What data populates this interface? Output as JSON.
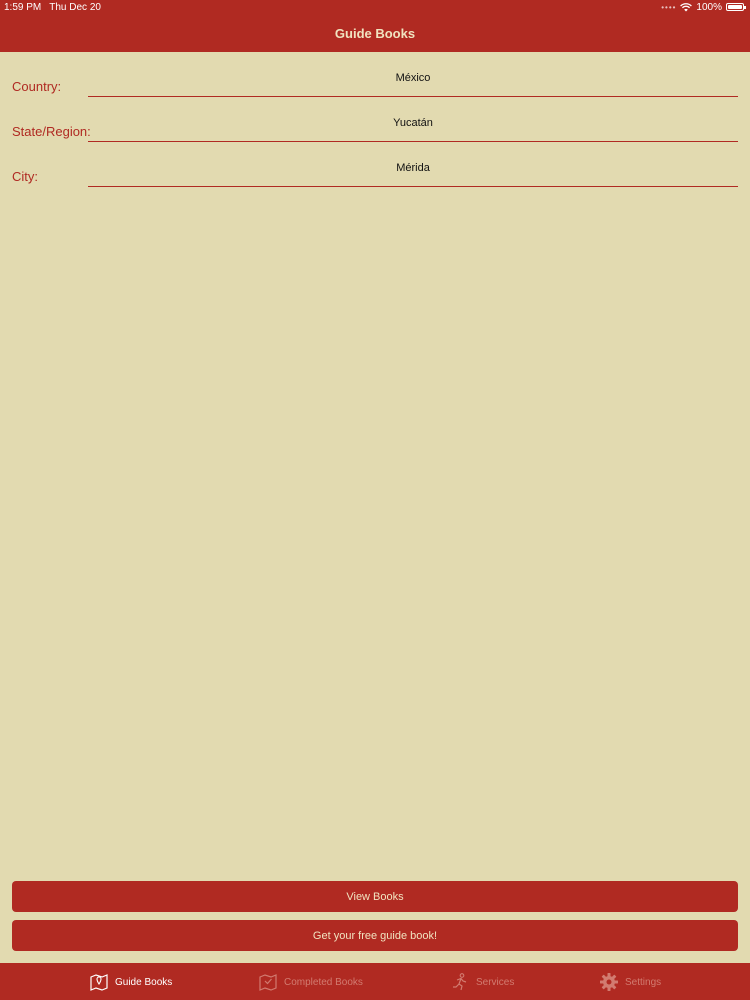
{
  "status_bar": {
    "time": "1:59 PM",
    "date": "Thu Dec 20",
    "battery": "100%"
  },
  "nav": {
    "title": "Guide Books"
  },
  "form": {
    "country_label": "Country:",
    "country_value": "México",
    "state_label": "State/Region:",
    "state_value": "Yucatán",
    "city_label": "City:",
    "city_value": "Mérida"
  },
  "buttons": {
    "view_books": "View Books",
    "free_book": "Get your free guide book!"
  },
  "tabs": [
    {
      "label": "Guide Books",
      "icon": "map-pin-book-icon",
      "active": true
    },
    {
      "label": "Completed Books",
      "icon": "completed-book-icon",
      "active": false
    },
    {
      "label": "Services",
      "icon": "runner-icon",
      "active": false
    },
    {
      "label": "Settings",
      "icon": "gear-icon",
      "active": false
    }
  ],
  "colors": {
    "accent": "#b02a22",
    "background": "#e2dab0",
    "tab_inactive": "#d27b70"
  }
}
